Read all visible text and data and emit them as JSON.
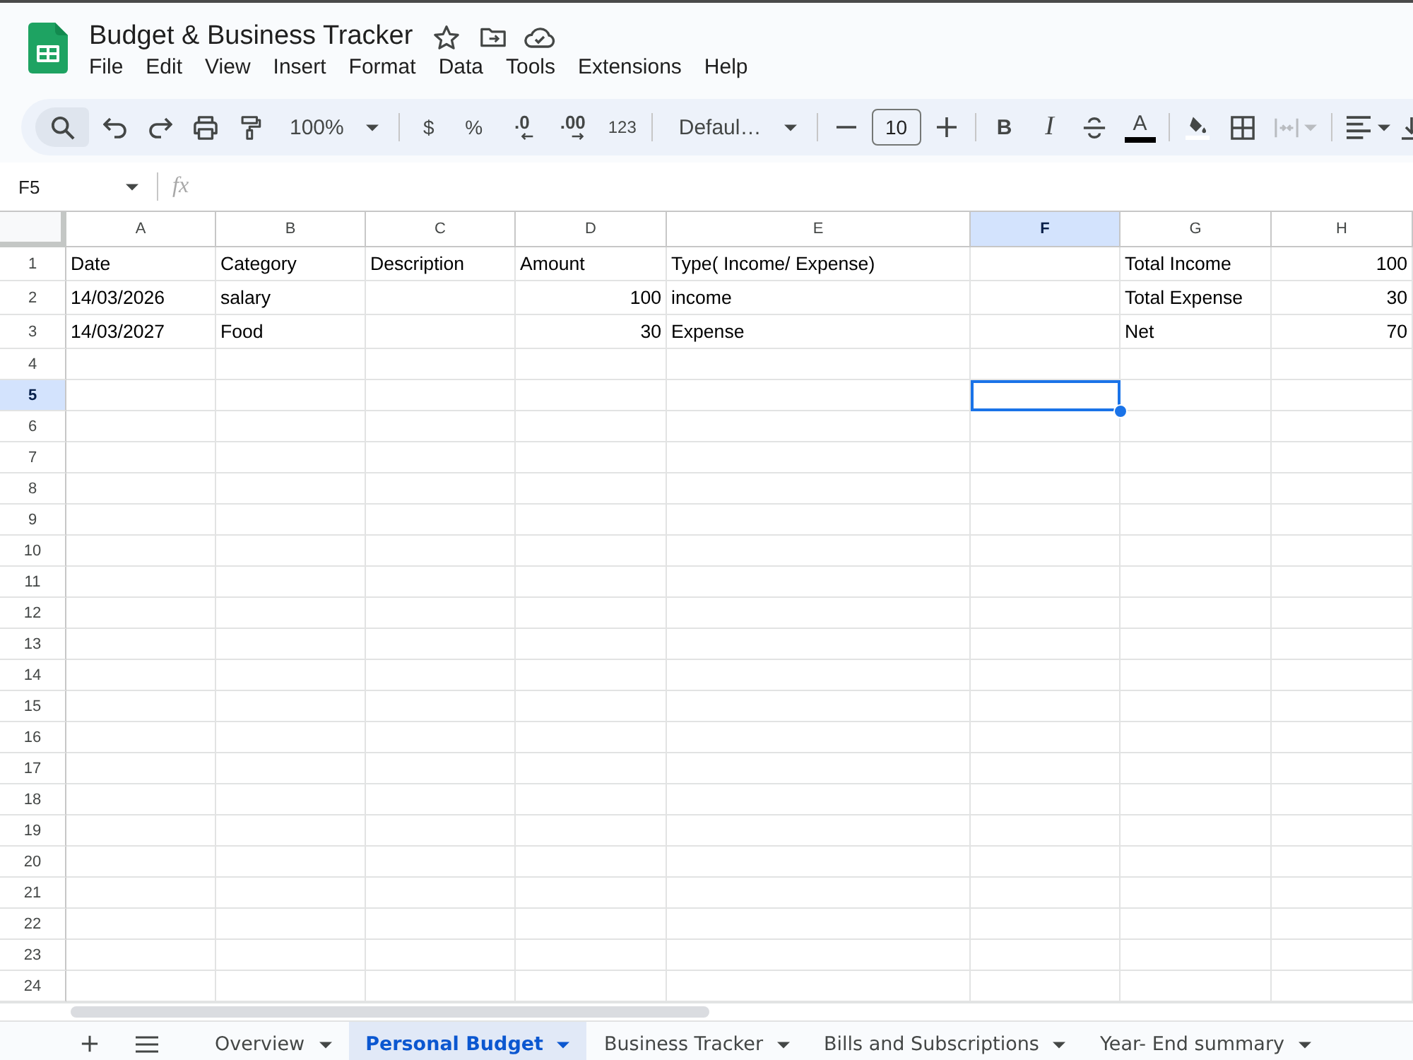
{
  "app": {
    "title": "Budget & Business Tracker",
    "menu": [
      "File",
      "Edit",
      "View",
      "Insert",
      "Format",
      "Data",
      "Tools",
      "Extensions",
      "Help"
    ]
  },
  "toolbar": {
    "search": {
      "active": true
    },
    "zoom": "100%",
    "currency": "$",
    "percent": "%",
    "decrease_decimal": ".0",
    "increase_decimal": ".00",
    "more_formats": "123",
    "font": "Defaul…",
    "font_size": "10",
    "bold": "B",
    "italic": "I",
    "text_color": "A",
    "merge_cells": {
      "disabled": true
    }
  },
  "formula_bar": {
    "name_box": "F5",
    "fx": "fx"
  },
  "sheet": {
    "columns": [
      {
        "label": "A",
        "selected": false
      },
      {
        "label": "B",
        "selected": false
      },
      {
        "label": "C",
        "selected": false
      },
      {
        "label": "D",
        "selected": false
      },
      {
        "label": "E",
        "selected": false
      },
      {
        "label": "F",
        "selected": true
      },
      {
        "label": "G",
        "selected": false
      },
      {
        "label": "H",
        "selected": false
      }
    ],
    "rows": [
      {
        "number": "1",
        "selected": false,
        "cells": [
          {
            "kind": "text",
            "text": "Date"
          },
          {
            "kind": "text",
            "text": "Category"
          },
          {
            "kind": "text",
            "text": "Description"
          },
          {
            "kind": "text",
            "text": "Amount"
          },
          {
            "kind": "text",
            "text": "Type( Income/ Expense)"
          },
          {
            "kind": "empty"
          },
          {
            "kind": "text",
            "text": "Total Income"
          },
          {
            "kind": "number",
            "text": "100"
          }
        ]
      },
      {
        "number": "2",
        "selected": false,
        "cells": [
          {
            "kind": "text",
            "text": "14/03/2026"
          },
          {
            "kind": "text",
            "text": "salary"
          },
          {
            "kind": "empty"
          },
          {
            "kind": "number",
            "text": "100"
          },
          {
            "kind": "text",
            "text": "income"
          },
          {
            "kind": "empty"
          },
          {
            "kind": "text",
            "text": "Total Expense"
          },
          {
            "kind": "number",
            "text": "30"
          }
        ]
      },
      {
        "number": "3",
        "selected": false,
        "cells": [
          {
            "kind": "text",
            "text": "14/03/2027"
          },
          {
            "kind": "text",
            "text": "Food"
          },
          {
            "kind": "empty"
          },
          {
            "kind": "number",
            "text": "30"
          },
          {
            "kind": "text",
            "text": "Expense"
          },
          {
            "kind": "empty"
          },
          {
            "kind": "text",
            "text": "Net"
          },
          {
            "kind": "number",
            "text": "70"
          }
        ]
      },
      {
        "number": "4",
        "selected": false
      },
      {
        "number": "5",
        "selected": true
      },
      {
        "number": "6",
        "selected": false
      },
      {
        "number": "7",
        "selected": false
      },
      {
        "number": "8",
        "selected": false
      },
      {
        "number": "9",
        "selected": false
      },
      {
        "number": "10",
        "selected": false
      },
      {
        "number": "11",
        "selected": false
      },
      {
        "number": "12",
        "selected": false
      },
      {
        "number": "13",
        "selected": false
      },
      {
        "number": "14",
        "selected": false
      },
      {
        "number": "15",
        "selected": false
      },
      {
        "number": "16",
        "selected": false
      },
      {
        "number": "17",
        "selected": false
      },
      {
        "number": "18",
        "selected": false
      },
      {
        "number": "19",
        "selected": false
      },
      {
        "number": "20",
        "selected": false
      },
      {
        "number": "21",
        "selected": false
      },
      {
        "number": "22",
        "selected": false
      },
      {
        "number": "23",
        "selected": false
      },
      {
        "number": "24",
        "selected": false
      }
    ]
  },
  "sheet_tabs": [
    {
      "label": "Overview",
      "selected": false
    },
    {
      "label": "Personal Budget",
      "selected": true
    },
    {
      "label": "Business Tracker",
      "selected": false
    },
    {
      "label": "Bills and Subscriptions",
      "selected": false
    },
    {
      "label": "Year- End summary",
      "selected": false
    }
  ]
}
